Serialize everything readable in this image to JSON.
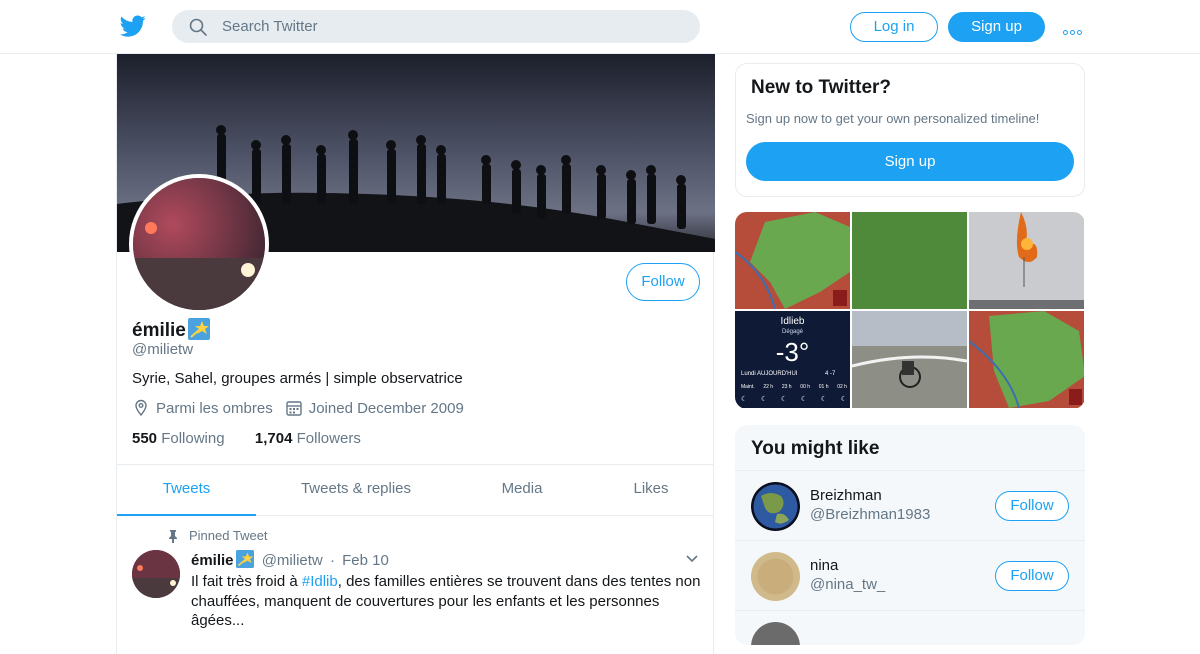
{
  "topbar": {
    "logo": "twitter-bird-icon",
    "search_placeholder": "Search Twitter",
    "login_label": "Log in",
    "signup_label": "Sign up",
    "more": "more-icon"
  },
  "profile": {
    "follow_label": "Follow",
    "name": "émilie",
    "handle": "@milietw",
    "bio": "Syrie, Sahel, groupes armés | simple observatrice",
    "location": "Parmi les ombres",
    "joined": "Joined December 2009",
    "following_count": "550",
    "following_label": "Following",
    "followers_count": "1,704",
    "followers_label": "Followers"
  },
  "tabs": [
    "Tweets",
    "Tweets & replies",
    "Media",
    "Likes"
  ],
  "pinned_tweet": {
    "label": "Pinned Tweet",
    "name": "émilie",
    "handle": "@milietw",
    "separator": "·",
    "date": "Feb 10",
    "text_before": "Il fait très froid à ",
    "hashtag": "#Idlib",
    "text_after": ", des familles entières se trouvent dans des tentes non chauffées, manquent de couvertures pour les enfants et les personnes âgées..."
  },
  "new_to_twitter": {
    "title": "New to Twitter?",
    "subtitle": "Sign up now to get your own personalized timeline!",
    "signup_label": "Sign up"
  },
  "weather_widget": {
    "city": "Idlieb",
    "condition": "Dégagé",
    "temp": "-3°",
    "day": "Lundi",
    "today": "AUJOURD'HUI",
    "hi_lo": "4  -7",
    "hours": [
      "Maint.",
      "22 h",
      "23 h",
      "00 h",
      "01 h",
      "02 h"
    ]
  },
  "you_might_like": {
    "title": "You might like",
    "accounts": [
      {
        "name": "Breizhman",
        "handle": "@Breizhman1983",
        "follow_label": "Follow"
      },
      {
        "name": "nina",
        "handle": "@nina_tw_",
        "follow_label": "Follow"
      }
    ]
  },
  "colors": {
    "accent": "#1da1f2",
    "text": "#14171a",
    "secondary": "#657786",
    "border": "#e6ecf0"
  }
}
